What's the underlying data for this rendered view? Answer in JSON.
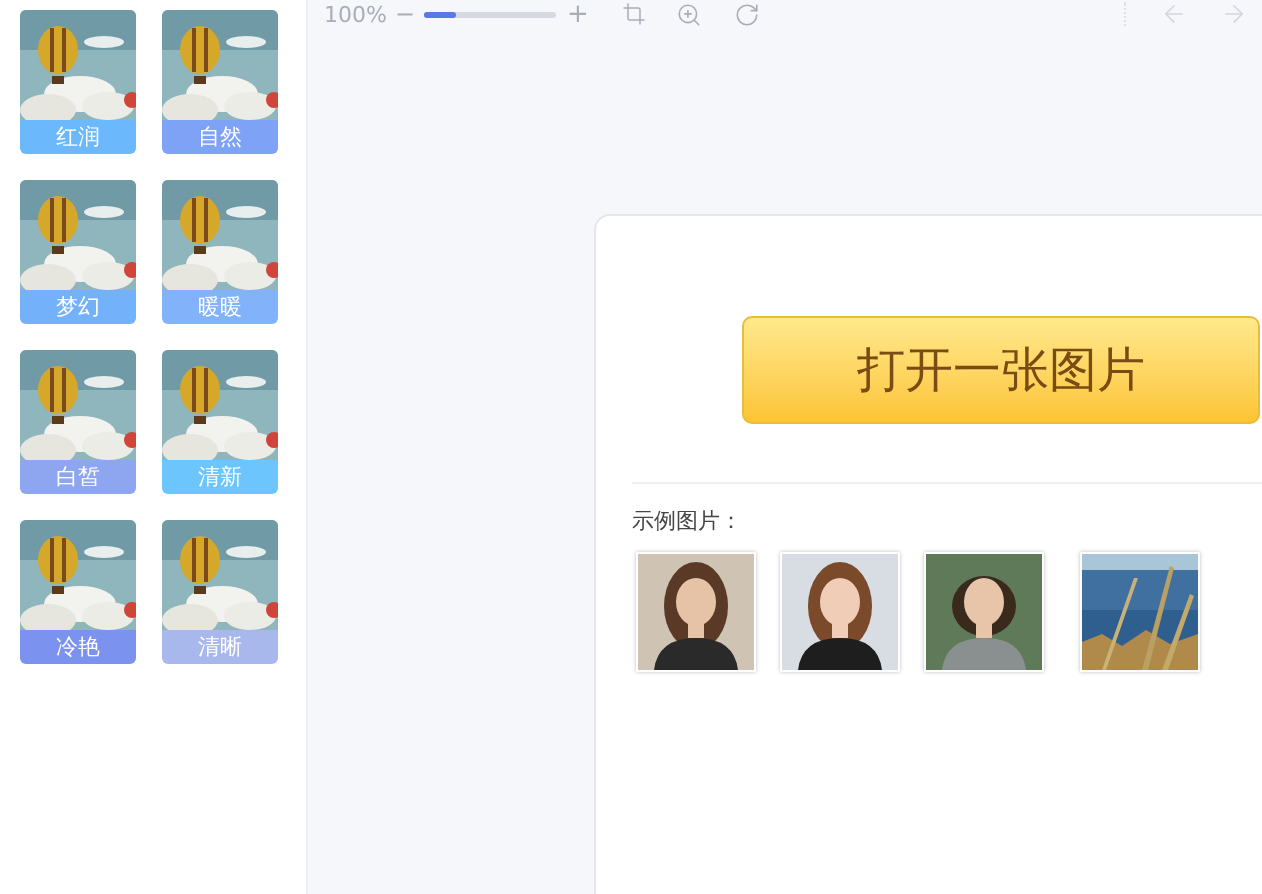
{
  "filters": [
    {
      "label": "红润",
      "color": "#6cb8fc"
    },
    {
      "label": "自然",
      "color": "#7ea2f6"
    },
    {
      "label": "梦幻",
      "color": "#74b1fb"
    },
    {
      "label": "暖暖",
      "color": "#82b2fa"
    },
    {
      "label": "白皙",
      "color": "#8ea6f0"
    },
    {
      "label": "清新",
      "color": "#6cc5fc"
    },
    {
      "label": "冷艳",
      "color": "#7b93ee"
    },
    {
      "label": "清晰",
      "color": "#a9b8ec"
    }
  ],
  "toolbar": {
    "zoom": "100%",
    "minus": "−",
    "plus": "+",
    "zoom_slider": {
      "level": 0.25
    }
  },
  "open_button": "打开一张图片",
  "samples": {
    "label": "示例图片："
  }
}
